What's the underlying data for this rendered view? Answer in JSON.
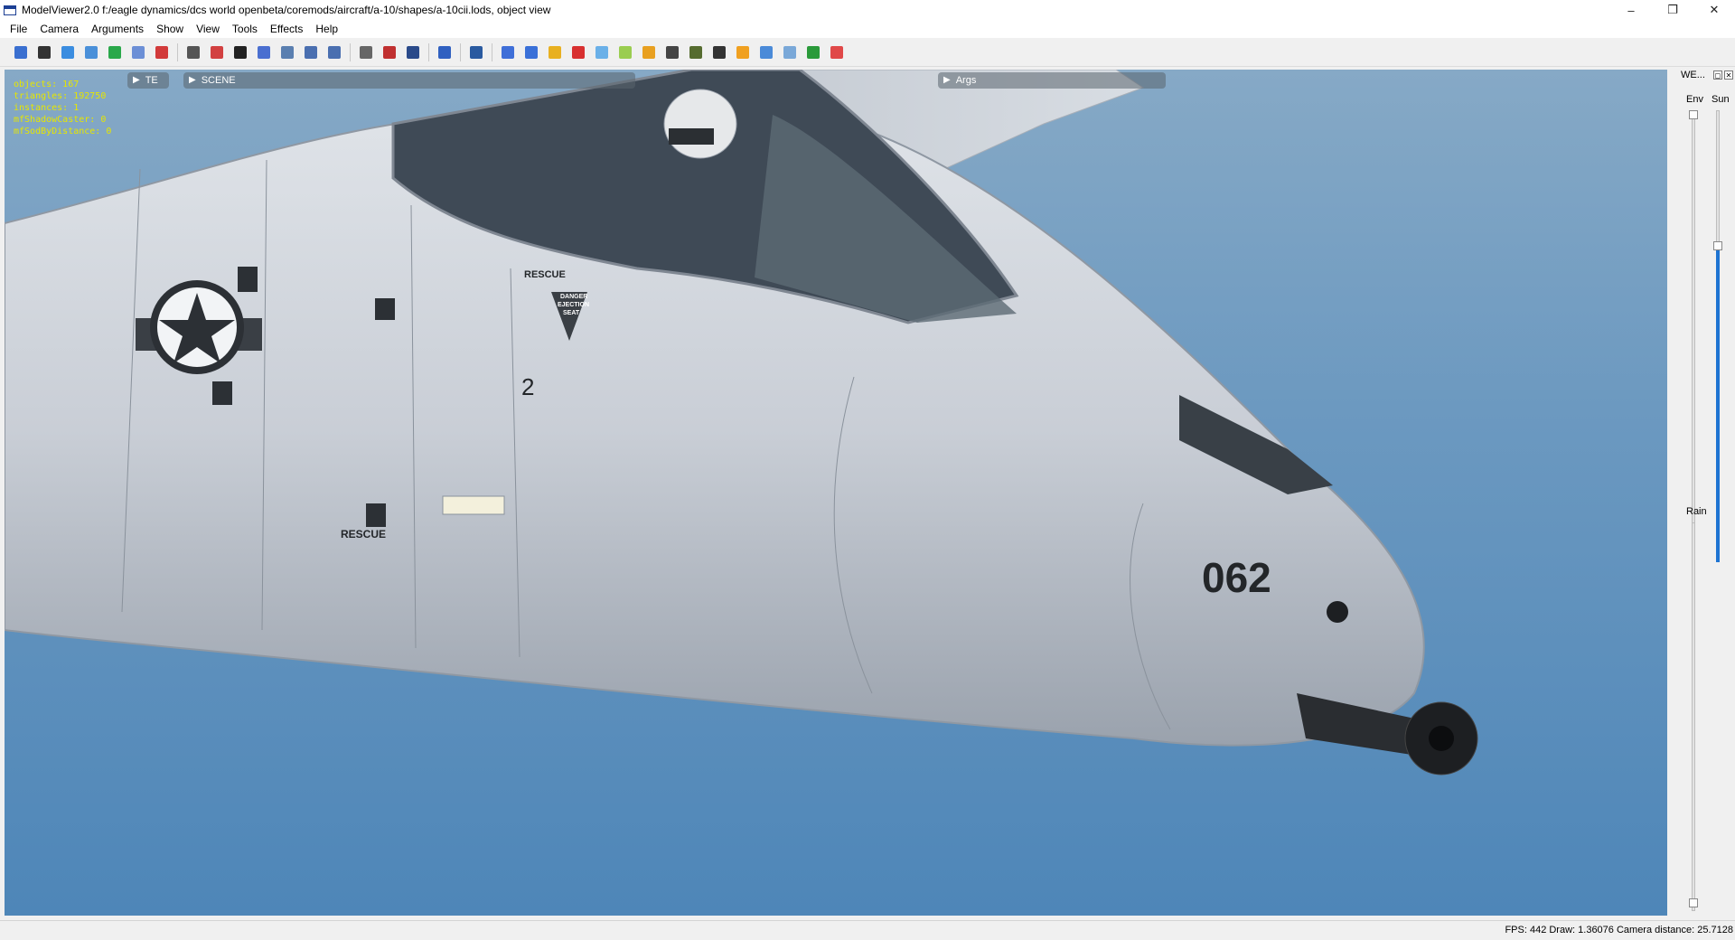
{
  "window": {
    "title": "ModelViewer2.0 f:/eagle dynamics/dcs world openbeta/coremods/aircraft/a-10/shapes/a-10cii.lods, object view",
    "minimize": "–",
    "restore": "❐",
    "close": "✕"
  },
  "menu": [
    {
      "label": "File"
    },
    {
      "label": "Camera"
    },
    {
      "label": "Arguments"
    },
    {
      "label": "Show"
    },
    {
      "label": "View"
    },
    {
      "label": "Tools"
    },
    {
      "label": "Effects"
    },
    {
      "label": "Help"
    }
  ],
  "toolbar": {
    "buttons": [
      {
        "icon": "save-icon",
        "color": "#3a6fd0"
      },
      {
        "icon": "camera-icon",
        "color": "#333333"
      },
      {
        "icon": "sphere-icon",
        "color": "#3b8de0"
      },
      {
        "icon": "refresh-icon",
        "color": "#4a90d9"
      },
      {
        "icon": "reload-icon",
        "color": "#2aa84a"
      },
      {
        "icon": "image-icon",
        "color": "#6c8fd6"
      },
      {
        "icon": "skeleton-icon",
        "color": "#d23a3a"
      },
      {
        "icon": "sep"
      },
      {
        "icon": "user-icon",
        "color": "#555555"
      },
      {
        "icon": "crosshair-icon",
        "color": "#d24040"
      },
      {
        "icon": "grid-dark-icon",
        "color": "#222222"
      },
      {
        "icon": "funnel-icon",
        "color": "#4a6fd0"
      },
      {
        "icon": "cone-icon",
        "color": "#5a7fb0"
      },
      {
        "icon": "arrow-right-icon",
        "color": "#4a6fb0"
      },
      {
        "icon": "arrow-left-icon",
        "color": "#4a6fb0"
      },
      {
        "icon": "sep"
      },
      {
        "icon": "portrait-icon",
        "color": "#666666"
      },
      {
        "icon": "colors-icon",
        "color": "#c03030"
      },
      {
        "icon": "monitor-icon",
        "color": "#2a4a8a"
      },
      {
        "icon": "sep"
      },
      {
        "icon": "undo-icon",
        "color": "#3060c0"
      },
      {
        "icon": "sep"
      },
      {
        "icon": "eye-icon",
        "color": "#2a5aa0"
      },
      {
        "icon": "sep"
      },
      {
        "icon": "bar-chart-icon",
        "color": "#3f6fd8"
      },
      {
        "icon": "cube-blue-icon",
        "color": "#3a70d8"
      },
      {
        "icon": "copy-icon",
        "color": "#e8b020"
      },
      {
        "icon": "cube-red-icon",
        "color": "#d83030"
      },
      {
        "icon": "cube-light-icon",
        "color": "#6ab0e8"
      },
      {
        "icon": "cube-green-icon",
        "color": "#9acd50"
      },
      {
        "icon": "chart-line-icon",
        "color": "#e8a020"
      },
      {
        "icon": "light-icon",
        "color": "#444444"
      },
      {
        "icon": "tank-icon",
        "color": "#556b2f"
      },
      {
        "icon": "car-icon",
        "color": "#333333"
      },
      {
        "icon": "sun-icon",
        "color": "#f0a020"
      },
      {
        "icon": "axes-icon",
        "color": "#4a8ad8"
      },
      {
        "icon": "grid-icon",
        "color": "#7aa8d8"
      },
      {
        "icon": "dots-grid-icon",
        "color": "#2a9a3a"
      },
      {
        "icon": "record-icon",
        "color": "#e04848"
      }
    ]
  },
  "viewport": {
    "stats": [
      "objects: 167",
      "triangles: 192750",
      "instances: 1",
      "mfShadowCaster: 0",
      "mfSodByDistance: 0"
    ],
    "panels": {
      "te": "TE",
      "scene": "SCENE",
      "args": "Args"
    },
    "aircraft": {
      "tail_number": "062",
      "rescue_label": "RESCUE",
      "ejection_danger": "DANGER",
      "ejection_line1": "EJECTION",
      "ejection_line2": "SEAT",
      "side_number": "2"
    }
  },
  "weather": {
    "title": "WE...",
    "env_label": "Env",
    "sun_label": "Sun",
    "rain_label": "Rain",
    "env_value": 1.0,
    "sun_value": 0.7,
    "rain_value": 0.0
  },
  "status": {
    "text": "FPS: 442  Draw: 1.36076  Camera distance: 25.7128"
  }
}
